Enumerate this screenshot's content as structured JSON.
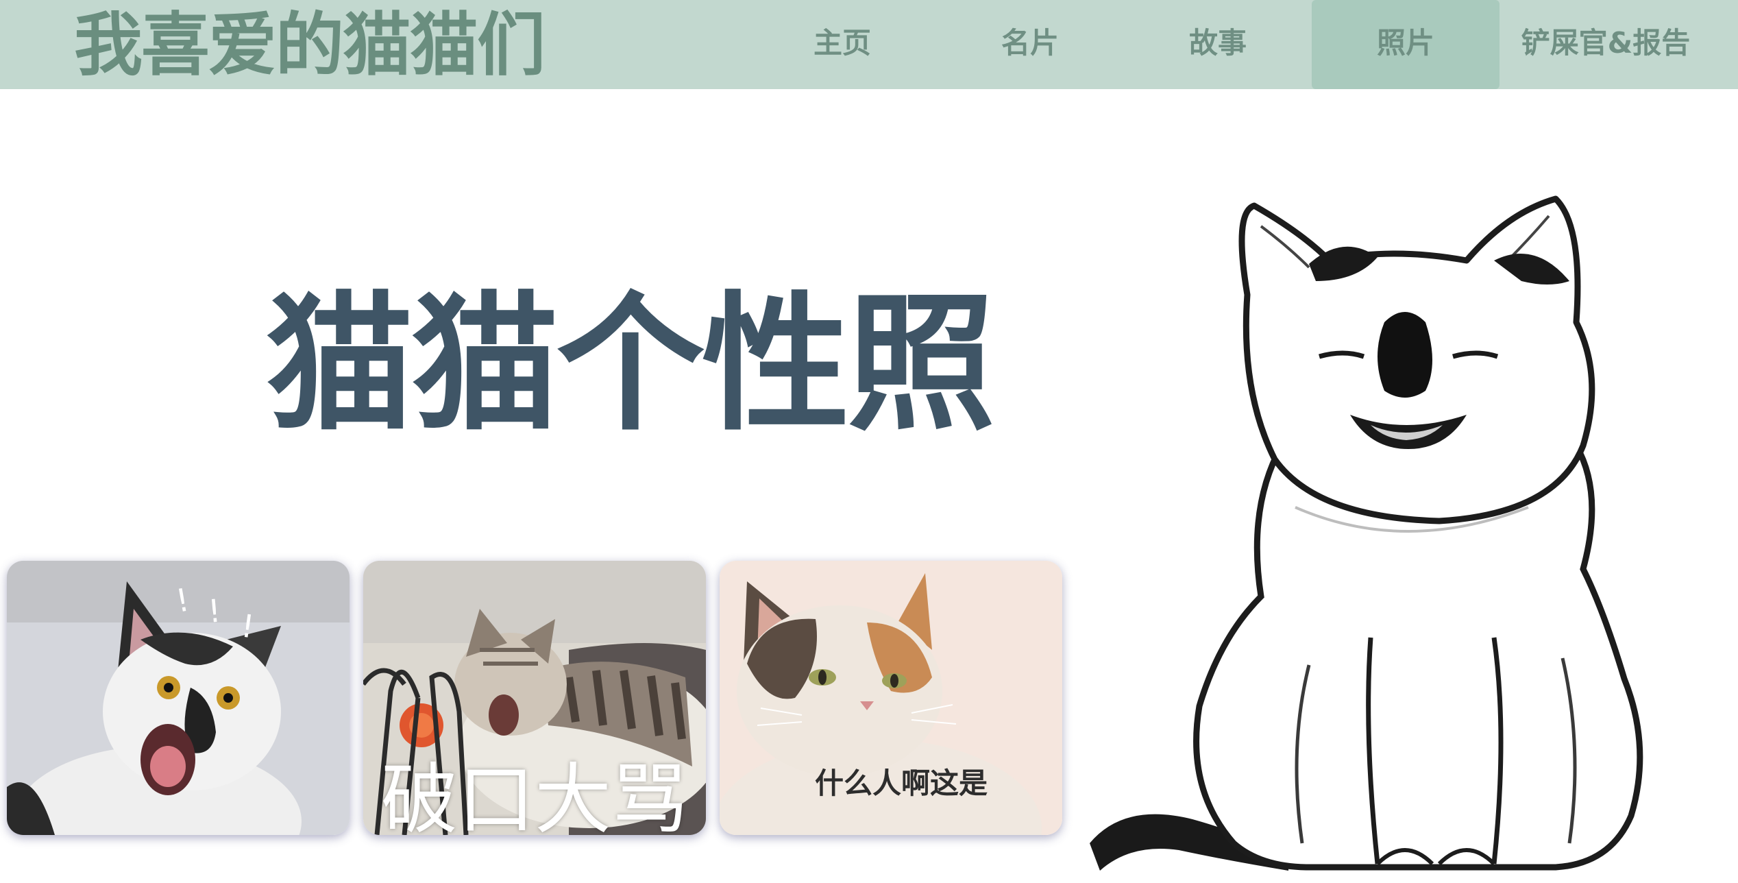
{
  "header": {
    "site_title": "我喜爱的猫猫们",
    "nav": [
      {
        "label": "主页",
        "active": false
      },
      {
        "label": "名片",
        "active": false
      },
      {
        "label": "故事",
        "active": false
      },
      {
        "label": "照片",
        "active": true
      },
      {
        "label": "铲屎官&报告",
        "active": false
      }
    ]
  },
  "main": {
    "heading": "猫猫个性照",
    "photos": [
      {
        "subject": "shouting-cat-photo",
        "caption": "",
        "exclaim": "! ! !"
      },
      {
        "subject": "tabby-cat-yelling-photo",
        "caption": "破口大骂"
      },
      {
        "subject": "calico-cat-photo",
        "caption": "什么人啊这是"
      }
    ],
    "illustration": "sketched-cat-illustration"
  },
  "colors": {
    "header_bg": "#c2d8cf",
    "nav_active_bg": "#a9cabd",
    "title_green": "#6a8e7f",
    "heading_slate": "#3f5566"
  }
}
